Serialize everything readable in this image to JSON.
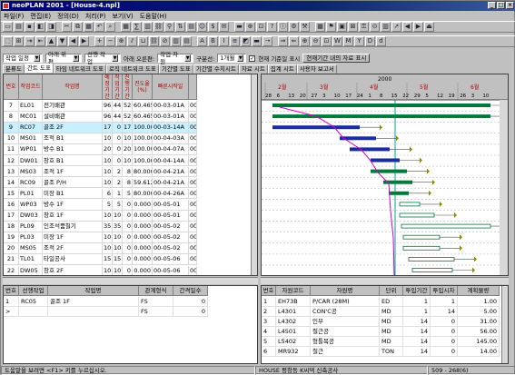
{
  "window": {
    "title": "neoPLAN 2001 - [House-4.npl]"
  },
  "menu": [
    "파일(F)",
    "편집(E)",
    "정의(D)",
    "처리(P)",
    "보기(V)",
    "도움말(H)"
  ],
  "toolbar1": [
    "new",
    "open",
    "save",
    "print",
    "preview",
    "cut",
    "copy",
    "paste",
    "undo",
    "find",
    "table",
    "calc",
    "chart",
    "link",
    "filter",
    "sort",
    "report",
    "resource",
    "cost",
    "mail",
    "bar",
    "zoom",
    "fit",
    "help",
    "info",
    "cfg",
    "tool",
    "grid",
    "flag",
    "calendar",
    "lock",
    "key",
    "binoc",
    "hist",
    "arrow",
    "back",
    "next",
    "exit"
  ],
  "toolbar2": [
    "sel",
    "tree",
    "indent",
    "outdent",
    "up",
    "down",
    "left",
    "right",
    "add",
    "del",
    "ins",
    "split",
    "merge",
    "link",
    "unlink",
    "col",
    "row",
    "font",
    "bold",
    "italic",
    "align",
    "color",
    "bar",
    "arrow",
    "fwd",
    "back",
    "zoomin",
    "zoomout",
    "all",
    "week",
    "month",
    "year",
    "date",
    "day"
  ],
  "options": {
    "work_range": "작업 일정",
    "dependency": "아래 위편",
    "selection": "선행 작업",
    "sort_label": "아래 오른편:",
    "sort_value": "작업 자원",
    "group_label": "구분선:",
    "group_value": "1개월",
    "show_baseline_label": "현재 기준일 표시",
    "show_baseline_checked": true,
    "period_button": "현재기간 내의 자료 표시"
  },
  "tabs": [
    "분류도",
    "간트 도표",
    "타임 네트워크 도표",
    "로직 네트워크 도표",
    "기간별 도표",
    "기간별 수치시트",
    "자료 시트",
    "집계 시트",
    "사용자 보고서"
  ],
  "active_tab": 1,
  "grid": {
    "headers": [
      "번호",
      "작업코드",
      "작업명",
      "예정기간",
      "작업기간",
      "진행기간",
      "진도율(%)",
      "빠른시작일",
      ""
    ],
    "rows": [
      {
        "no": "7",
        "code": "EL01",
        "name": "전기배관",
        "d1": "96",
        "d2": "44",
        "d3": "52",
        "pct": "60.465",
        "start": "00-03-01A",
        "x": "00-"
      },
      {
        "no": "8",
        "code": "MC01",
        "name": "설비배관",
        "d1": "96",
        "d2": "44",
        "d3": "52",
        "pct": "60.465",
        "start": "00-03-01A",
        "x": "00-"
      },
      {
        "no": "9",
        "code": "RC07",
        "name": "골조 2F",
        "d1": "17",
        "d2": "0",
        "d3": "17",
        "pct": "100.000",
        "start": "00-03-14A",
        "x": "00-"
      },
      {
        "no": "10",
        "code": "MS01",
        "name": "조적 B1",
        "d1": "10",
        "d2": "0",
        "d3": "10",
        "pct": "100.000",
        "start": "00-04-03A",
        "x": "00-"
      },
      {
        "no": "11",
        "code": "WP01",
        "name": "방수 B1",
        "d1": "20",
        "d2": "0",
        "d3": "20",
        "pct": "100.000",
        "start": "00-04-07A",
        "x": "00-"
      },
      {
        "no": "12",
        "code": "DW01",
        "name": "창호 B1",
        "d1": "10",
        "d2": "0",
        "d3": "10",
        "pct": "100.000",
        "start": "00-04-14A",
        "x": "00-"
      },
      {
        "no": "13",
        "code": "MS03",
        "name": "조적 1F",
        "d1": "10",
        "d2": "2",
        "d3": "8",
        "pct": "80.000",
        "start": "00-04-21A",
        "x": "00-"
      },
      {
        "no": "14",
        "code": "RC09",
        "name": "골조 P/H",
        "d1": "10",
        "d2": "2",
        "d3": "8",
        "pct": "59.612",
        "start": "00-04-21A",
        "x": "00-"
      },
      {
        "no": "15",
        "code": "PL01",
        "name": "미장 B1",
        "d1": "6",
        "d2": "1",
        "d3": "5",
        "pct": "80.000",
        "start": "00-04-26A",
        "x": "00-"
      },
      {
        "no": "16",
        "code": "WP03",
        "name": "방수 1F",
        "d1": "5",
        "d2": "5",
        "d3": "0",
        "pct": "0.000",
        "start": "00-05-01",
        "x": "00-"
      },
      {
        "no": "17",
        "code": "DW03",
        "name": "창호 1F",
        "d1": "10",
        "d2": "10",
        "d3": "0",
        "pct": "0.000",
        "start": "00-05-01",
        "x": "00-"
      },
      {
        "no": "18",
        "code": "PL09",
        "name": "인조석뿜칠기",
        "d1": "35",
        "d2": "35",
        "d3": "0",
        "pct": "0.000",
        "start": "00-05-02",
        "x": "00-"
      },
      {
        "no": "19",
        "code": "PL03",
        "name": "미장 1F",
        "d1": "10",
        "d2": "10",
        "d3": "0",
        "pct": "0.000",
        "start": "00-05-02",
        "x": "00-"
      },
      {
        "no": "20",
        "code": "MS05",
        "name": "조적 2F",
        "d1": "10",
        "d2": "10",
        "d3": "0",
        "pct": "0.000",
        "start": "00-05-02",
        "x": "00-"
      },
      {
        "no": "21",
        "code": "TL01",
        "name": "타일공사",
        "d1": "15",
        "d2": "15",
        "d3": "0",
        "pct": "0.000",
        "start": "00-05-06",
        "x": "00-"
      },
      {
        "no": "22",
        "code": "DW05",
        "name": "창호 2F",
        "d1": "10",
        "d2": "10",
        "d3": "0",
        "pct": "0.000",
        "start": "00-05-06",
        "x": "00-"
      }
    ],
    "selected_row": 2
  },
  "gantt": {
    "year": "2000",
    "months": [
      "2월",
      "3월",
      "4월",
      "5월",
      "6월"
    ],
    "days": [
      "28",
      "6",
      "13",
      "20",
      "27",
      "3",
      "10",
      "17",
      "24",
      "1",
      "8",
      "15",
      "22",
      "29",
      "5",
      "12",
      "19",
      "26",
      "3",
      "10"
    ]
  },
  "pred_table": {
    "headers": [
      "번호",
      "선행작업",
      "작업명",
      "관계형식",
      "간격일수"
    ],
    "rows": [
      {
        "no": "1",
        "code": "RC05",
        "name": "골조 1F",
        "type": "FS",
        "gap": "0"
      },
      {
        "no": ">",
        "code": "",
        "name": "",
        "type": "FS",
        "gap": "0"
      }
    ]
  },
  "res_table": {
    "headers": [
      "번호",
      "자원코드",
      "자원명",
      "단위",
      "투입기간",
      "투입시차",
      "계획물량"
    ],
    "rows": [
      {
        "no": "1",
        "code": "EH73B",
        "name": "P/CAR (28M)",
        "unit": "ED",
        "dur": "1",
        "lag": "1",
        "qty": "1.00"
      },
      {
        "no": "2",
        "code": "L4301",
        "name": "CON'C공",
        "unit": "MD",
        "dur": "1",
        "lag": "14",
        "qty": "5.00"
      },
      {
        "no": "3",
        "code": "L4302",
        "name": "인부",
        "unit": "MD",
        "dur": "14",
        "lag": "0",
        "qty": "31.00"
      },
      {
        "no": "4",
        "code": "L4501",
        "name": "철근공",
        "unit": "MD",
        "dur": "14",
        "lag": "0",
        "qty": "56.00"
      },
      {
        "no": "5",
        "code": "L5402",
        "name": "형틀목공",
        "unit": "MD",
        "dur": "14",
        "lag": "0",
        "qty": "145.00"
      },
      {
        "no": "6",
        "code": "MR932",
        "name": "철근",
        "unit": "TON",
        "dur": "14",
        "lag": "0",
        "qty": "14.00"
      }
    ]
  },
  "status": {
    "help": "도움말을 보려면 <F1> 키를 누르십시오.",
    "project": "HOUSE 평창동 K씨댁 신축공사",
    "pos": "509 - 268(6)"
  }
}
